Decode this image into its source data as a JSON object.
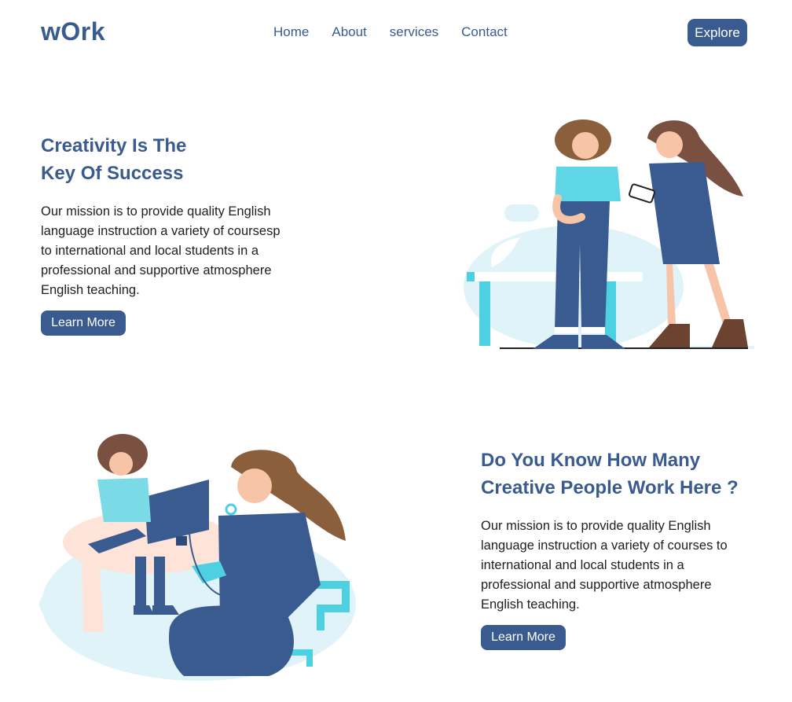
{
  "header": {
    "brand": "wOrk",
    "nav": [
      "Home",
      "About",
      "services",
      "Contact"
    ],
    "explore_label": "Explore"
  },
  "hero": {
    "title_line1": "Creativity Is The",
    "title_line2": "Key Of Success",
    "desc_lines": [
      "Our mission is to provide quality English",
      "language instruction a variety of coursesp",
      "to international and local students in a",
      "professional and supportive atmosphere",
      "English teaching."
    ],
    "button_label": "Learn More"
  },
  "section2": {
    "title_line1": "Do You Know How Many",
    "title_line2": "Creative People Work Here ?",
    "desc_lines": [
      "Our mission is to provide quality English",
      "language instruction a variety of courses to",
      "international and local students in a",
      "professional and supportive atmosphere",
      "English teaching."
    ],
    "button_label": "Learn More"
  },
  "colors": {
    "primary": "#3a5b8f",
    "accent_cyan": "#4dd0e1",
    "light_cyan": "#dff3f8",
    "hair_brown": "#8b5e3c",
    "skin": "#f7c4a8"
  }
}
